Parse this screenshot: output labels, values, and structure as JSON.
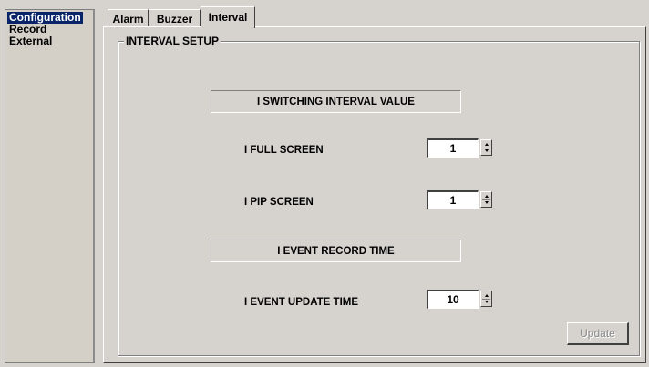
{
  "sidebar": {
    "items": [
      {
        "label": "Configuration",
        "selected": true
      },
      {
        "label": "Record",
        "selected": false
      },
      {
        "label": "External",
        "selected": false
      }
    ]
  },
  "tabs": [
    {
      "label": "Alarm",
      "active": false
    },
    {
      "label": "Buzzer",
      "active": false
    },
    {
      "label": "Interval",
      "active": true
    }
  ],
  "group": {
    "title": "INTERVAL SETUP",
    "sections": {
      "switching": "I SWITCHING INTERVAL VALUE",
      "event_record": "I EVENT RECORD TIME"
    },
    "fields": {
      "full_screen": {
        "label": "I  FULL  SCREEN",
        "value": "1"
      },
      "pip_screen": {
        "label": "I  PIP  SCREEN",
        "value": "1"
      },
      "event_update": {
        "label": "I  EVENT UPDATE TIME",
        "value": "10"
      }
    },
    "update_label": "Update"
  },
  "colors": {
    "window_bg": "#d6d3ce",
    "selection_bg": "#0a246a",
    "disabled_text": "#8a8a8a"
  }
}
